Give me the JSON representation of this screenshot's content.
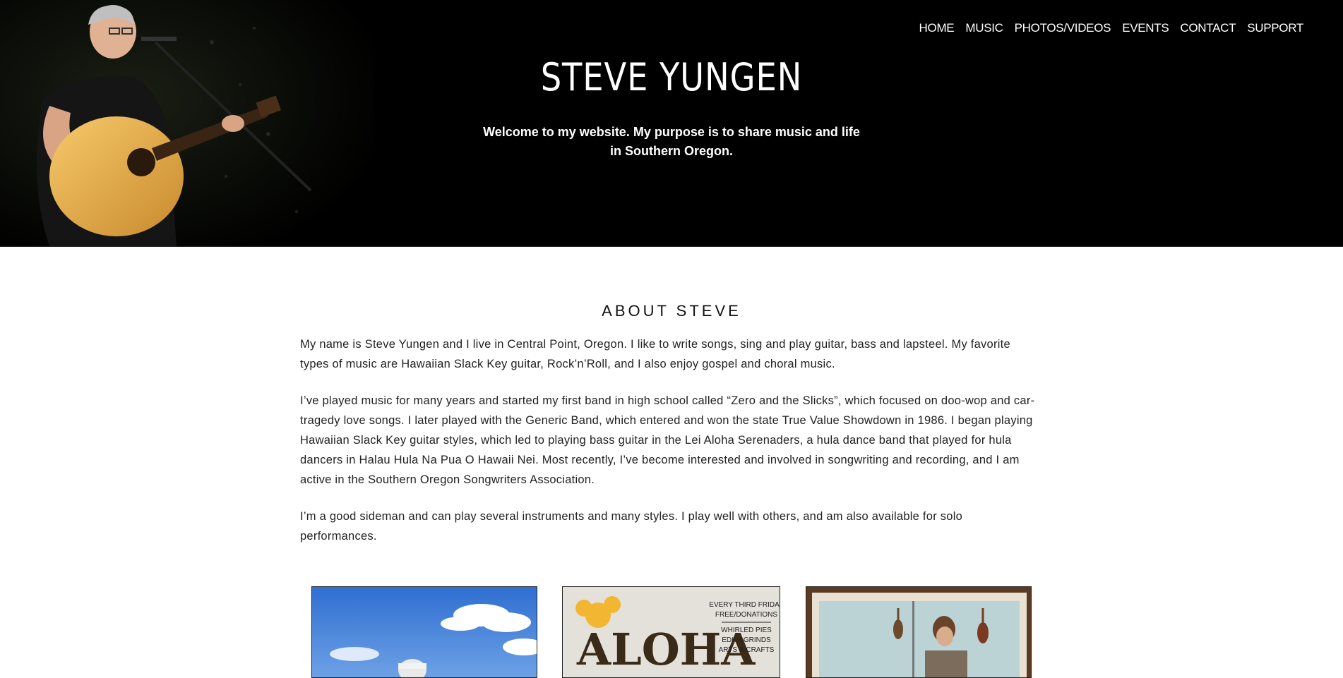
{
  "nav": {
    "items": [
      "HOME",
      "MUSIC",
      "PHOTOS/VIDEOS",
      "EVENTS",
      "CONTACT",
      "SUPPORT"
    ]
  },
  "hero": {
    "title": "STEVE YUNGEN",
    "tagline_line1": "Welcome to my website. My purpose is to share music and life",
    "tagline_line2": "in Southern Oregon."
  },
  "about": {
    "heading": "ABOUT STEVE",
    "paragraphs": [
      "My name is Steve Yungen and I live in Central Point, Oregon. I like to write songs, sing and play guitar, bass and lapsteel. My favorite types of music are Hawaiian Slack Key guitar, Rock’n’Roll, and I also enjoy gospel and choral music.",
      "I’ve played music for many years and started my first band in high school called “Zero and the Slicks”, which focused on doo-wop and car-tragedy love songs. I later played with the Generic Band, which entered and won the state True Value Showdown in 1986. I began playing Hawaiian Slack Key guitar styles, which led to playing bass guitar in the Lei Aloha Serenaders, a hula dance band that played for hula dancers in Halau Hula Na Pua O Hawaii Nei. Most recently, I’ve become interested and involved in songwriting and recording, and I am active in the Southern Oregon Songwriters Association.",
      "I’m a good sideman and can play several instruments and many styles. I play well with others, and am also available for solo performances."
    ]
  },
  "gallery": {
    "poster_lines": [
      "EVERY THIRD FRIDAY",
      "FREE/DONATIONS",
      "WHIRLED PIES",
      "EDKH GRINDS",
      "ARTS & CRAFTS"
    ],
    "poster_title": "ALOHA"
  },
  "colors": {
    "hero_bg": "#000000",
    "text_dark": "#222222",
    "accent_yellow": "#f2b632"
  }
}
